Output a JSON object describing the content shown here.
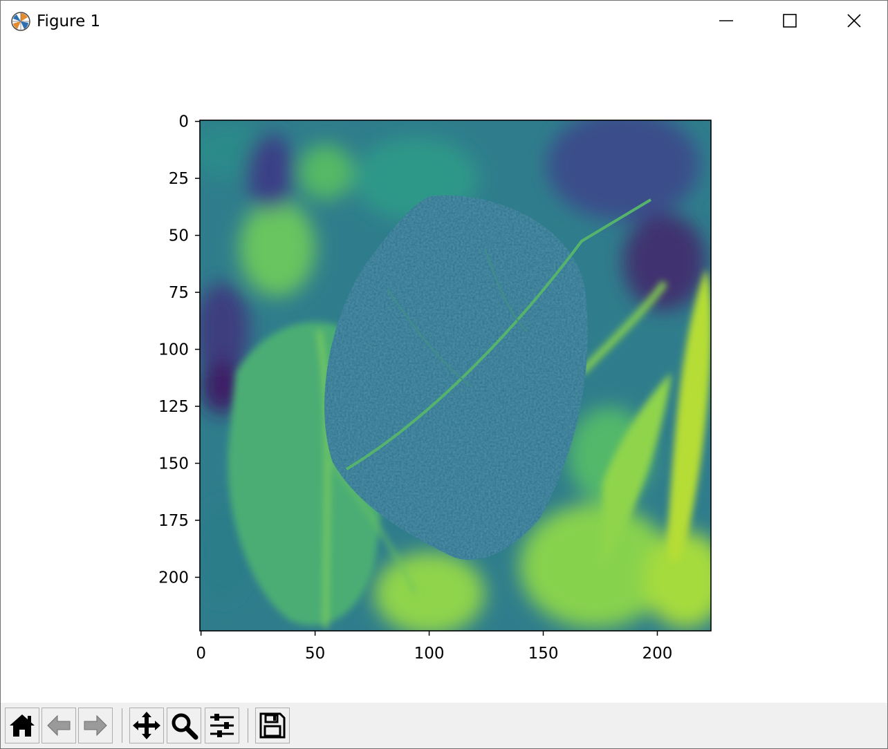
{
  "window": {
    "title": "Figure 1",
    "controls": [
      "minimize",
      "maximize",
      "close"
    ]
  },
  "toolbar": {
    "buttons": [
      {
        "name": "home",
        "icon": "home-icon",
        "state": "enabled"
      },
      {
        "name": "back",
        "icon": "back-arrow-icon",
        "state": "disabled"
      },
      {
        "name": "forward",
        "icon": "forward-arrow-icon",
        "state": "disabled"
      },
      {
        "name": "pan",
        "icon": "move-icon",
        "state": "enabled"
      },
      {
        "name": "zoom",
        "icon": "magnifier-icon",
        "state": "enabled"
      },
      {
        "name": "subplots",
        "icon": "sliders-icon",
        "state": "enabled"
      },
      {
        "name": "save",
        "icon": "floppy-disk-icon",
        "state": "enabled"
      }
    ]
  },
  "chart_data": {
    "type": "heatmap",
    "title": "",
    "xlabel": "",
    "ylabel": "",
    "image_shape": [
      224,
      224
    ],
    "colormap": "viridis",
    "description_of_content": "leaf",
    "xlim": [
      -0.5,
      223.5
    ],
    "ylim": [
      223.5,
      -0.5
    ],
    "x_ticks": [
      0,
      50,
      100,
      150,
      200
    ],
    "y_ticks": [
      0,
      25,
      50,
      75,
      100,
      125,
      150,
      175,
      200
    ],
    "x_tick_labels": [
      "0",
      "50",
      "100",
      "150",
      "200"
    ],
    "y_tick_labels": [
      "0",
      "25",
      "50",
      "75",
      "100",
      "125",
      "150",
      "175",
      "200"
    ],
    "grid": false,
    "legend": "none"
  }
}
